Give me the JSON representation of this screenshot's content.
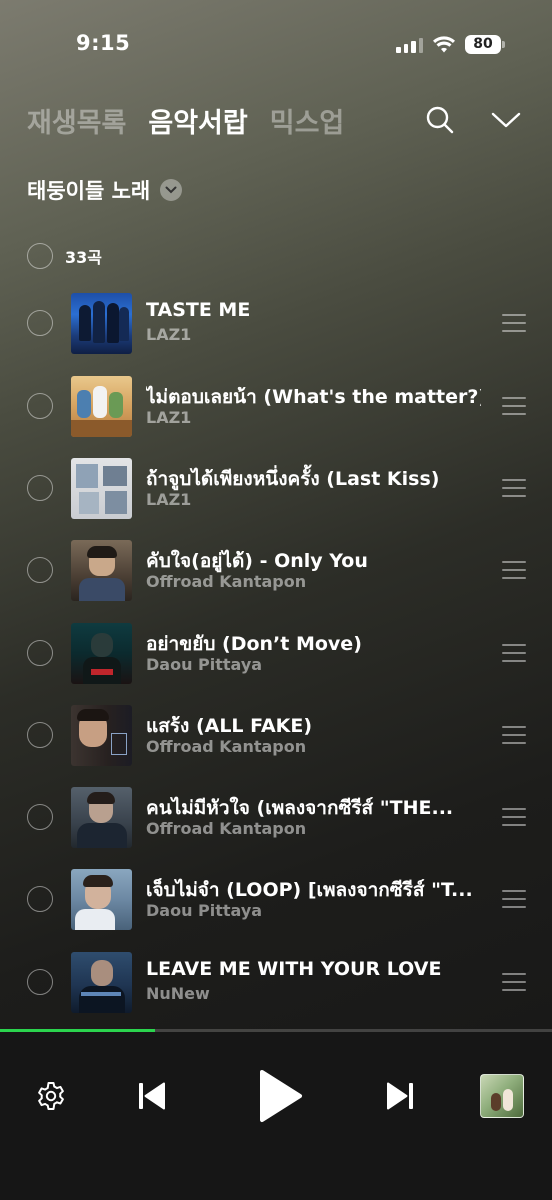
{
  "status": {
    "time": "9:15",
    "battery": "80"
  },
  "tabs": [
    {
      "label": "재생목록",
      "active": false
    },
    {
      "label": "음악서랍",
      "active": true
    },
    {
      "label": "믹스업",
      "active": false
    }
  ],
  "icons": {
    "search": "search-icon",
    "collapse": "chevron-down-icon",
    "dropdown": "chevron-down-icon",
    "settings": "gear-icon",
    "prev": "skip-previous-icon",
    "play": "play-icon",
    "next": "skip-next-icon"
  },
  "playlist": {
    "title": "태둥이들 노래",
    "count": "33곡"
  },
  "tracks": [
    {
      "title": "TASTE ME",
      "artist": "LAZ1"
    },
    {
      "title": "ไม่ตอบเลยน้า (What's the matter?)",
      "artist": "LAZ1"
    },
    {
      "title": "ถ้าจูบได้เพียงหนึ่งครั้ง (Last Kiss)",
      "artist": "LAZ1"
    },
    {
      "title": "คับใจ(อยู่ได้) - Only You",
      "artist": "Offroad Kantapon"
    },
    {
      "title": "อย่าขยับ (Don’t Move)",
      "artist": "Daou Pittaya"
    },
    {
      "title": "แสร้ง (ALL FAKE)",
      "artist": "Offroad Kantapon"
    },
    {
      "title": "คนไม่มีหัวใจ (เพลงจากซีรีส์ \"THE...",
      "artist": "Offroad Kantapon"
    },
    {
      "title": "เจ็บไม่จำ (LOOP) [เพลงจากซีรีส์ \"T...",
      "artist": "Daou Pittaya"
    },
    {
      "title": "LEAVE ME WITH YOUR LOVE",
      "artist": "NuNew"
    }
  ],
  "player": {
    "progress": 0.28
  },
  "colors": {
    "accent": "#2bd44e",
    "background": "#161616"
  }
}
